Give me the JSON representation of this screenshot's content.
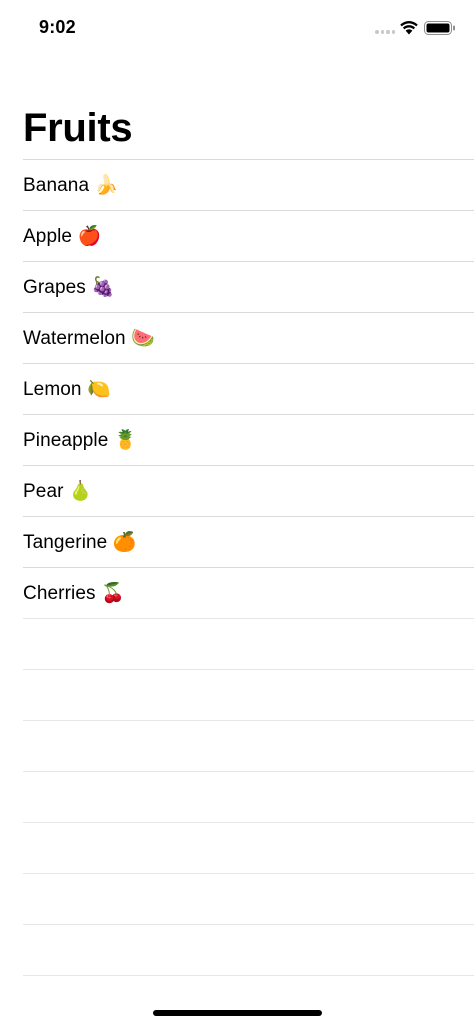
{
  "status_bar": {
    "time": "9:02"
  },
  "nav": {
    "title": "Fruits"
  },
  "fruits": [
    {
      "label": "Banana 🍌"
    },
    {
      "label": "Apple 🍎"
    },
    {
      "label": "Grapes 🍇"
    },
    {
      "label": "Watermelon 🍉"
    },
    {
      "label": "Lemon 🍋"
    },
    {
      "label": "Pineapple 🍍"
    },
    {
      "label": "Pear 🍐"
    },
    {
      "label": "Tangerine 🍊"
    },
    {
      "label": "Cherries 🍒"
    }
  ],
  "icons": {
    "signal": "cellular-signal-icon",
    "wifi": "wifi-icon",
    "battery": "battery-icon"
  }
}
